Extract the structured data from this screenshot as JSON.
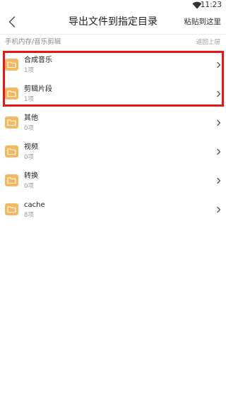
{
  "status_bar": {
    "time": "11:23",
    "wifi_icon": "wifi-icon"
  },
  "header": {
    "back_icon": "back-arrow-icon",
    "title": "导出文件到指定目录",
    "paste_label": "粘贴到这里"
  },
  "path_bar": {
    "path": "手机内存/音乐剪辑",
    "up_label": "返回上层"
  },
  "folders": [
    {
      "name": "合成音乐",
      "count": "1项",
      "icon": "folder-icon"
    },
    {
      "name": "剪辑片段",
      "count": "1项",
      "icon": "folder-icon"
    },
    {
      "name": "其他",
      "count": "0项",
      "icon": "folder-icon"
    },
    {
      "name": "视频",
      "count": "0项",
      "icon": "folder-icon"
    },
    {
      "name": "转换",
      "count": "0项",
      "icon": "folder-icon"
    },
    {
      "name": "cache",
      "count": "8项",
      "icon": "folder-icon"
    }
  ],
  "colors": {
    "folder": "#f5b860",
    "highlight": "#e01818"
  }
}
